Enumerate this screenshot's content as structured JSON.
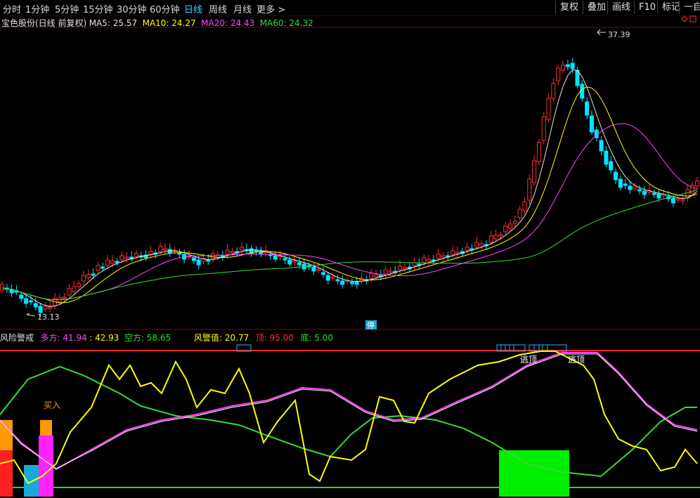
{
  "toolbar": {
    "periods": [
      "分时",
      "1分钟",
      "5分钟",
      "15分钟",
      "30分钟",
      "60分钟",
      "日线",
      "周线",
      "月线",
      "更多 >"
    ],
    "active_period": "日线",
    "buttons": [
      "复权",
      "叠加",
      "画线",
      "F10",
      "标记",
      "一自"
    ]
  },
  "main": {
    "stock_title": "宝色股份(日线 前复权)",
    "ma": [
      {
        "label": "MA5: 25.57",
        "color": "#e6e6e6"
      },
      {
        "label": "MA10: 24.27",
        "color": "#ffff00"
      },
      {
        "label": "MA20: 24.43",
        "color": "#ff44ff"
      },
      {
        "label": "MA60: 24.32",
        "color": "#33dd33"
      }
    ],
    "high_label": "37.39",
    "low_label": "13.13",
    "halt_label": "停"
  },
  "indicator": {
    "title": "风险警戒",
    "duo_label": "多方: 41.94",
    "value2": ": 42.93",
    "kong_label": "空方: 58.65",
    "warn_label": "风警值: 20.77",
    "top_label": "顶: 95.00",
    "bottom_label": "底: 5.00",
    "buy_label": "买入",
    "escape_labels": [
      "逃顶",
      "逃顶"
    ]
  },
  "colors": {
    "up": "#ff3030",
    "down": "#00e5ff",
    "ma5": "#e6e6e6",
    "ma10": "#ffff00",
    "ma20": "#ff44ff",
    "ma60": "#33dd33",
    "duo": "#ff44ff",
    "kong": "#33dd33",
    "risk": "#ffff00",
    "top_line": "#ff2020",
    "bottom_line": "#22dd22"
  }
}
